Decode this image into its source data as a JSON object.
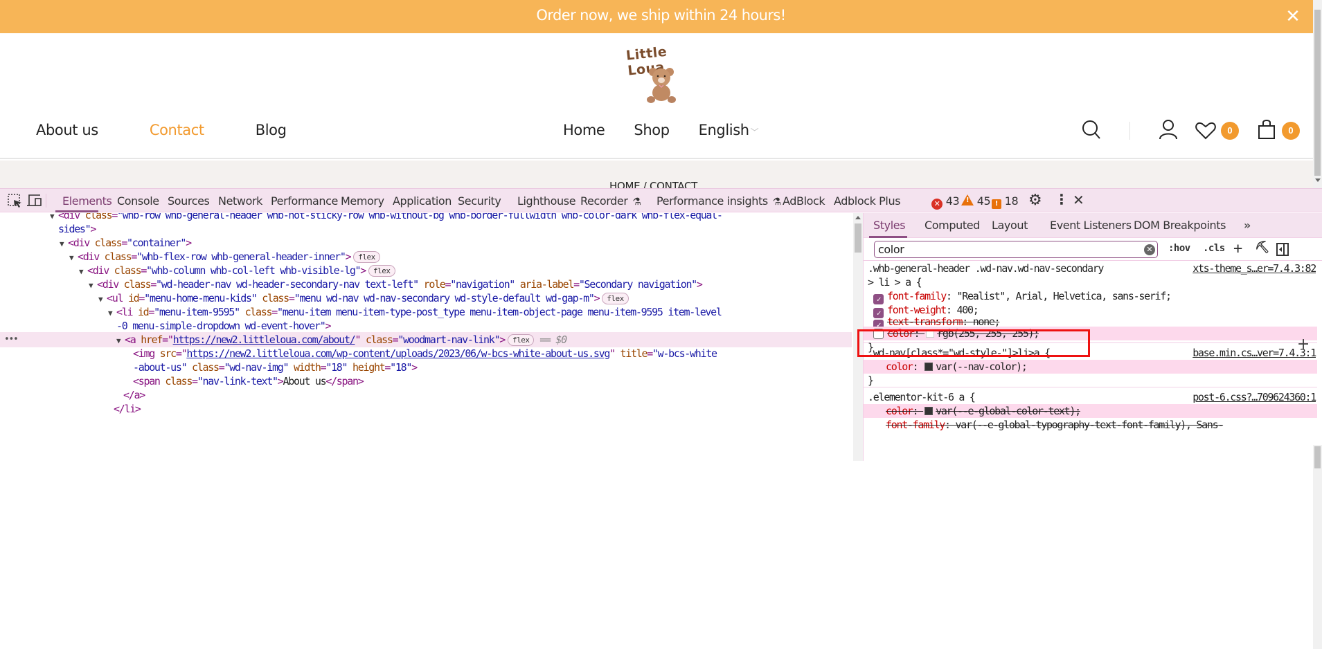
{
  "promo": {
    "text": "Order now, we ship within 24 hours!",
    "close_icon": "close-icon",
    "bg_color": "#f7b557"
  },
  "site": {
    "logo_text": "Little Loua",
    "nav_left": [
      {
        "label": "About us",
        "active": false
      },
      {
        "label": "Contact",
        "active": true
      },
      {
        "label": "Blog",
        "active": false
      }
    ],
    "nav_center": [
      {
        "label": "Home"
      },
      {
        "label": "Shop"
      },
      {
        "label": "English",
        "has_dropdown": true
      }
    ],
    "icons": {
      "search": "search-icon",
      "account": "user-icon",
      "wishlist": "heart-icon",
      "cart": "shopping-bag-icon"
    },
    "wishlist_count": "0",
    "cart_count": "0",
    "accent_color": "#f29a2e",
    "breadcrumb": "HOME  /  CONTACT"
  },
  "devtools": {
    "tabs": [
      {
        "label": "Elements",
        "active": true
      },
      {
        "label": "Console"
      },
      {
        "label": "Sources"
      },
      {
        "label": "Network"
      },
      {
        "label": "Performance"
      },
      {
        "label": "Memory"
      },
      {
        "label": "Application"
      },
      {
        "label": "Security"
      },
      {
        "label": "Lighthouse"
      },
      {
        "label": "Recorder",
        "experimental": true
      },
      {
        "label": "Performance insights",
        "experimental": true
      },
      {
        "label": "AdBlock"
      },
      {
        "label": "Adblock Plus"
      }
    ],
    "counts": {
      "errors": "43",
      "warnings": "45",
      "issues": "18"
    },
    "dom": {
      "line1a": "<div ",
      "line1_attr": "class",
      "line1_val": "\"whb-row whb-general-header whb-not-sticky-row whb-without-bg whb-border-fullwidth whb-color-dark whb-flex-equal-",
      "line1b_val": "sides\"",
      "line2_val": "\"container\"",
      "line3_val": "\"whb-flex-row whb-general-header-inner\"",
      "line4_val": "\"whb-column whb-col-left whb-visible-lg\"",
      "line5_val1": "\"wd-header-nav wd-header-secondary-nav text-left\"",
      "line5_attr2": "role",
      "line5_val2": "\"navigation\"",
      "line5_attr3": "aria-label",
      "line5_val3": "\"Secondary navigation\"",
      "line6_attr1": "id",
      "line6_val1": "\"menu-home-menu-kids\"",
      "line6_val2": "\"menu wd-nav wd-nav-secondary wd-style-default wd-gap-m\"",
      "line7_val1": "\"menu-item-9595\"",
      "line7_val2": "\"menu-item menu-item-type-post_type menu-item-object-page menu-item-9595 item-level",
      "line7b_val": "-0 menu-simple-dropdown wd-event-hover\"",
      "line8_attr1": "href",
      "line8_link": "https://new2.littleloua.com/about/",
      "line8_val2": "\"woodmart-nav-link\"",
      "selected_marker": "== $0",
      "line9_attr1": "src",
      "line9_link": "https://new2.littleloua.com/wp-content/uploads/2023/06/w-bcs-white-about-us.svg",
      "line9_attr2": "title",
      "line9_val2": "\"w-bcs-white",
      "line9b_val": "-about-us\"",
      "line9b_class_val": "\"wd-nav-img\"",
      "line9b_w_attr": "width",
      "line9b_w_val": "\"18\"",
      "line9b_h_attr": "height",
      "line9b_h_val": "\"18\"",
      "line10_val": "\"nav-link-text\"",
      "line10_text": "About us",
      "badge_flex": "flex",
      "ellipsis": "•••"
    },
    "styles": {
      "subtabs": [
        {
          "label": "Styles",
          "active": true
        },
        {
          "label": "Computed"
        },
        {
          "label": "Layout"
        },
        {
          "label": "Event Listeners"
        },
        {
          "label": "DOM Breakpoints"
        }
      ],
      "more": "»",
      "filter_value": "color",
      "hov": ":hov",
      "cls": ".cls",
      "rules": [
        {
          "selector1": ".whb-general-header .wd-nav.wd-nav-secondary",
          "selector2": "> li > a {",
          "source": "xts-theme_s…er=7.4.3:82",
          "decls": [
            {
              "prop": "font-family",
              "value": "\"Realist\", Arial, Helvetica, sans-serif;",
              "checked": true
            },
            {
              "prop": "font-weight",
              "value": "400;",
              "checked": true
            },
            {
              "prop": "text-transform",
              "value": "none;",
              "checked": true,
              "struck": true
            },
            {
              "prop": "color",
              "value": "rgb(255, 255, 255);",
              "checked": false,
              "struck": true
            }
          ]
        },
        {
          "selector1": ".wd-nav[class*=\"wd-style-\"]>li>a {",
          "source": "base.min.cs…ver=7.4.3:1",
          "decls": [
            {
              "prop": "color",
              "value": "var(--nav-color);"
            }
          ]
        },
        {
          "selector1": ".elementor-kit-6 a {",
          "source": "post-6.css?…709624360:1",
          "decls": [
            {
              "prop": "color",
              "value": "var(--e-global-color-text);",
              "struck": true
            },
            {
              "prop": "font-family",
              "value": "var(--e-global-typography-text-font-family), Sans-",
              "struck": true
            }
          ]
        }
      ],
      "close_brace": "}"
    }
  }
}
